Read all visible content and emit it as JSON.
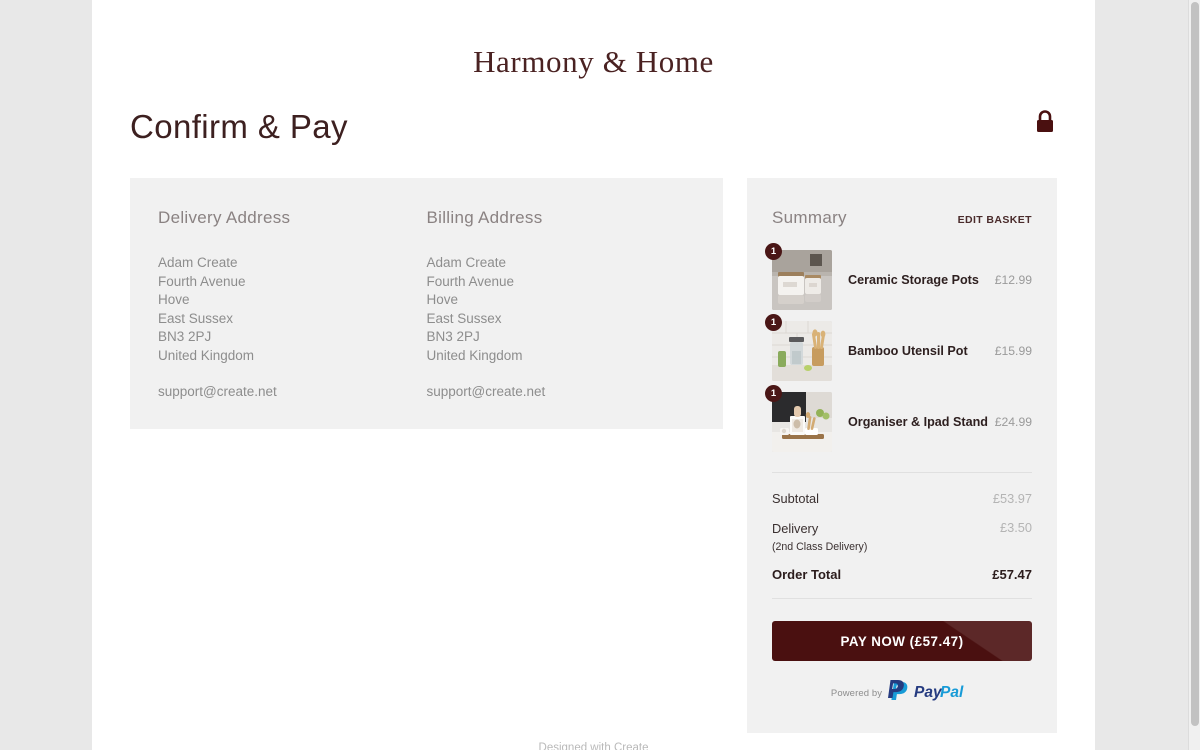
{
  "site": {
    "logo_text": "Harmony & Home",
    "footer_text": "Designed with Create"
  },
  "header": {
    "page_title": "Confirm & Pay",
    "secure_icon": "padlock-icon"
  },
  "colors": {
    "brand_dark": "#4a1010",
    "brand_logo": "#4a2222",
    "panel_bg": "#f1f1f1",
    "page_bg": "#e8e8e8",
    "muted_text": "#8d8d8d",
    "paypal_dark_blue": "#253B80",
    "paypal_light_blue": "#179BD7"
  },
  "delivery_address": {
    "heading": "Delivery Address",
    "lines": [
      "Adam Create",
      "Fourth Avenue",
      "Hove",
      "East Sussex",
      "BN3 2PJ",
      "United Kingdom"
    ],
    "email": "support@create.net"
  },
  "billing_address": {
    "heading": "Billing Address",
    "lines": [
      "Adam Create",
      "Fourth Avenue",
      "Hove",
      "East Sussex",
      "BN3 2PJ",
      "United Kingdom"
    ],
    "email": "support@create.net"
  },
  "summary": {
    "title": "Summary",
    "edit_basket_label": "EDIT BASKET",
    "items": [
      {
        "qty": "1",
        "name": "Ceramic Storage Pots",
        "price": "£12.99",
        "thumb_alt": "white ceramic storage pots with wooden lids on kitchen counter"
      },
      {
        "qty": "1",
        "name": "Bamboo Utensil Pot",
        "price": "£15.99",
        "thumb_alt": "blender and bamboo utensil pot against white subway tiles"
      },
      {
        "qty": "1",
        "name": "Organiser & Ipad Stand",
        "price": "£24.99",
        "thumb_alt": "wooden kitchen organiser with ipad stand"
      }
    ],
    "subtotal_label": "Subtotal",
    "subtotal_value": "£53.97",
    "delivery_label": "Delivery",
    "delivery_method": "(2nd Class Delivery)",
    "delivery_value": "£3.50",
    "order_total_label": "Order Total",
    "order_total_value": "£57.47",
    "pay_button_label": "PAY NOW (£57.47)",
    "powered_by_label": "Powered by",
    "paypal_word_1": "Pay",
    "paypal_word_2": "Pal"
  }
}
